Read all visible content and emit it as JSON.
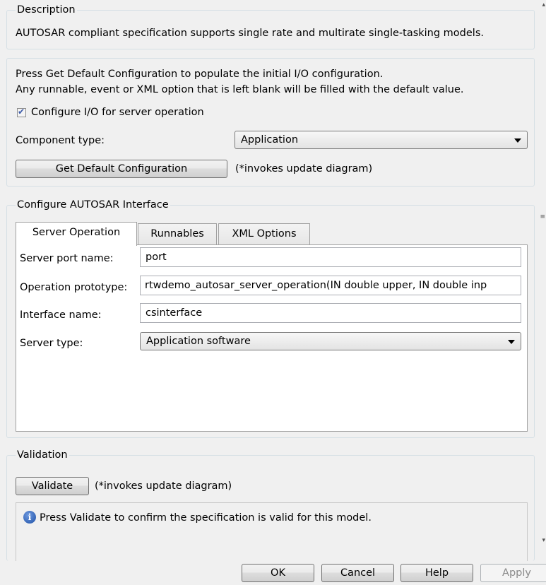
{
  "description": {
    "title": "Description",
    "text": "AUTOSAR compliant specification supports single rate and multirate single-tasking models."
  },
  "config": {
    "line1": "Press Get Default Configuration to populate the initial I/O configuration.",
    "line2": "Any runnable, event or XML option that is left blank will be filled with the default value.",
    "checkbox_label": "Configure I/O for server operation",
    "checkbox_checked": true,
    "component_type_label": "Component type:",
    "component_type_value": "Application",
    "get_default_button": "Get Default Configuration",
    "update_note": "(*invokes update diagram)"
  },
  "interface": {
    "title": "Configure AUTOSAR Interface",
    "tabs": [
      {
        "label": "Server Operation",
        "active": true
      },
      {
        "label": "Runnables",
        "active": false
      },
      {
        "label": "XML Options",
        "active": false
      }
    ],
    "fields": {
      "server_port_label": "Server port name:",
      "server_port_value": "port",
      "operation_label": "Operation prototype:",
      "operation_value": "rtwdemo_autosar_server_operation(IN double upper, IN double inp",
      "interface_label": "Interface name:",
      "interface_value": "csinterface",
      "server_type_label": "Server type:",
      "server_type_value": "Application software"
    }
  },
  "validation": {
    "title": "Validation",
    "button": "Validate",
    "note": "(*invokes update diagram)",
    "message": "Press Validate to confirm the specification is valid for this model."
  },
  "footer": {
    "ok": "OK",
    "cancel": "Cancel",
    "help": "Help",
    "apply": "Apply"
  },
  "icons": {
    "info": "info-icon",
    "check": "checkmark-icon",
    "dropdown": "chevron-down-icon"
  }
}
